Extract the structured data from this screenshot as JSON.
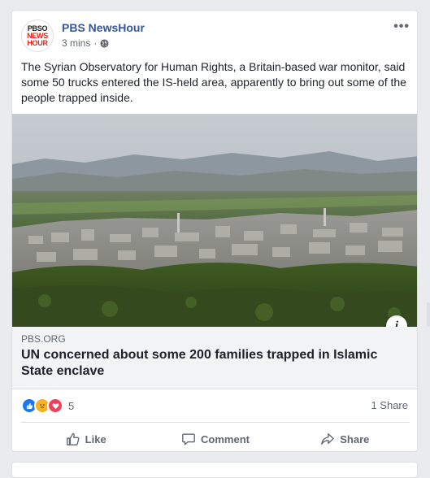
{
  "post": {
    "page_name": "PBS NewsHour",
    "logo_lines": [
      "PBSO",
      "NEWS",
      "HOUR"
    ],
    "timestamp": "3 mins",
    "privacy_dot": "·",
    "body_text": "The Syrian Observatory for Human Rights, a Britain-based war monitor, said some 50 trucks entered the IS-held area, apparently to bring out some of the people trapped inside.",
    "more_label": "•••"
  },
  "link": {
    "domain": "PBS.ORG",
    "headline": "UN concerned about some 200 families trapped in Islamic State enclave",
    "info_label": "i"
  },
  "stats": {
    "reaction_icons": [
      "like-icon",
      "sad-icon",
      "love-icon"
    ],
    "reaction_count": "5",
    "shares": "1 Share"
  },
  "actions": {
    "like": "Like",
    "comment": "Comment",
    "share": "Share"
  },
  "colors": {
    "link_blue": "#365899",
    "like_blue": "#1877f2",
    "love_red": "#f33e58",
    "sad_yellow": "#f7b125"
  }
}
